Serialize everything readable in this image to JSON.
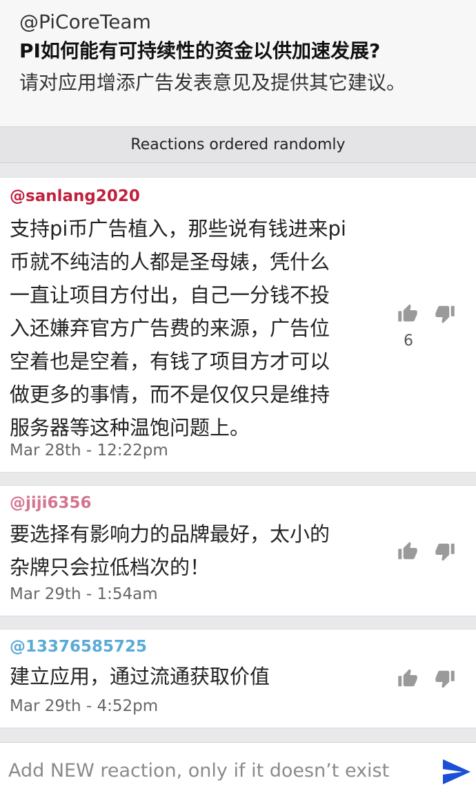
{
  "header": {
    "handle": "@PiCoreTeam",
    "title": "PI如何能有可持续性的资金以供加速发展?",
    "subtitle": "请对应用增添广告发表意见及提供其它建议。"
  },
  "sort_banner": {
    "label": "Reactions ordered randomly"
  },
  "reactions": [
    {
      "author": "@sanlang2020",
      "author_color": "#c0213f",
      "lines": [
        "支持pi币广告植入，那些说有钱进来pi",
        "币就不纯洁的人都是圣母婊，凭什么",
        "一直让项目方付出，自己一分钱不投",
        "入还嫌弃官方广告费的来源，广告位",
        "空着也是空着，有钱了项目方才可以",
        "做更多的事情，而不是仅仅只是维持",
        "服务器等这种温饱问题上。"
      ],
      "timestamp": "Mar 28th - 12:22pm",
      "upvotes": "6",
      "upvote_icon": "thumbs-up-icon",
      "downvote_icon": "thumbs-down-icon"
    },
    {
      "author": "@jiji6356",
      "author_color": "#d4758f",
      "lines": [
        "要选择有影响力的品牌最好，太小的",
        "杂牌只会拉低档次的！"
      ],
      "timestamp": "Mar 29th - 1:54am",
      "upvote_icon": "thumbs-up-icon",
      "downvote_icon": "thumbs-down-icon"
    },
    {
      "author": "@13376585725",
      "author_color": "#5aaad6",
      "lines": [
        "建立应用，通过流通获取价值"
      ],
      "timestamp": "Mar 29th - 4:52pm",
      "upvote_icon": "thumbs-up-icon",
      "downvote_icon": "thumbs-down-icon"
    }
  ],
  "composer": {
    "placeholder": "Add NEW reaction, only if it doesn’t exist",
    "send_icon": "send-icon",
    "send_color": "#1a4fd6"
  }
}
